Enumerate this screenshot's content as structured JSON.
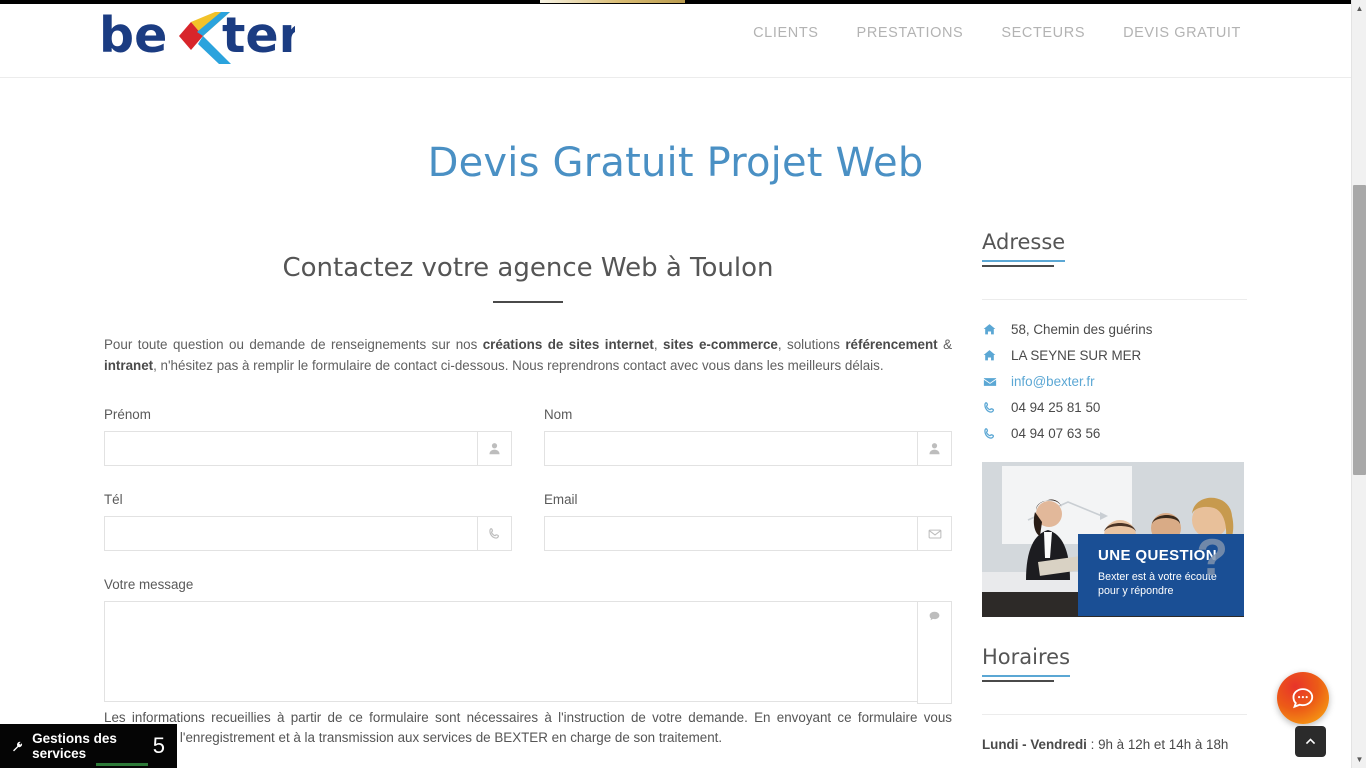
{
  "brand": {
    "logo_text": "bexter",
    "logo_colors": {
      "text": "#1b3c82",
      "x_red": "#d8252b",
      "x_blue": "#2ba3dd",
      "x_yellow": "#f2c229"
    }
  },
  "nav": {
    "items": [
      {
        "label": "CLIENTS",
        "name": "nav-clients"
      },
      {
        "label": "PRESTATIONS",
        "name": "nav-prestations"
      },
      {
        "label": "SECTEURS",
        "name": "nav-secteurs"
      },
      {
        "label": "DEVIS GRATUIT",
        "name": "nav-devis-gratuit"
      }
    ]
  },
  "hero": {
    "title": "Devis Gratuit Projet Web",
    "color": "#4a90c4"
  },
  "main": {
    "heading": "Contactez votre agence Web à Toulon",
    "intro": {
      "part1": "Pour toute question ou demande de renseignements sur nos ",
      "b1": "créations de sites internet",
      "part2": ", ",
      "b2": "sites e-commerce",
      "part3": ", solutions ",
      "b3": "référencement",
      "part4": " & ",
      "b4": "intranet",
      "part5": ", n'hésitez pas à remplir le formulaire de contact ci-dessous. Nous reprendrons contact avec vous dans les meilleurs délais."
    },
    "consent": "Les informations recueillies à partir de ce formulaire sont nécessaires à l'instruction de votre demande. En envoyant ce formulaire vous consentez à l'enregistrement et à la transmission aux services de BEXTER en charge de son traitement."
  },
  "form": {
    "fields": [
      {
        "label": "Prénom",
        "value": "",
        "placeholder": "",
        "icon": "user-icon",
        "name": "prenom"
      },
      {
        "label": "Nom",
        "value": "",
        "placeholder": "",
        "icon": "user-icon",
        "name": "nom"
      },
      {
        "label": "Tél",
        "value": "",
        "placeholder": "",
        "icon": "phone-icon",
        "name": "tel"
      },
      {
        "label": "Email",
        "value": "",
        "placeholder": "",
        "icon": "envelope-icon",
        "name": "email"
      }
    ],
    "message": {
      "label": "Votre message",
      "value": "",
      "placeholder": "",
      "icon": "comment-icon"
    }
  },
  "sidebar": {
    "address_title": "Adresse",
    "contacts": [
      {
        "icon": "home-icon",
        "text": "58, Chemin des guérins",
        "link": false
      },
      {
        "icon": "home-icon",
        "text": "LA SEYNE SUR MER",
        "link": false
      },
      {
        "icon": "envelope-icon",
        "text": "info@bexter.fr",
        "link": true
      },
      {
        "icon": "phone-icon",
        "text": "04 94 25 81 50",
        "link": false
      },
      {
        "icon": "phone-icon",
        "text": "04 94 07 63 56",
        "link": false
      }
    ],
    "promo": {
      "title": "UNE QUESTION",
      "subtitle_line1": "Bexter est à votre écoute",
      "subtitle_line2": "pour y répondre",
      "question_mark": "?",
      "bg_color": "#1a4f95"
    },
    "horaires_title": "Horaires",
    "horaires_days": "Lundi - Vendredi",
    "horaires_hours": " : 9h à 12h et 14h à 18h"
  },
  "widgets": {
    "chat": {
      "name": "chat-bubble-button",
      "icon": "chat-icon"
    },
    "scroll_top": {
      "name": "scroll-to-top-button",
      "icon": "chevron-up-icon"
    },
    "service_badge": {
      "label": "Gestions des services",
      "count": "5",
      "icon": "wrench-icon"
    }
  }
}
